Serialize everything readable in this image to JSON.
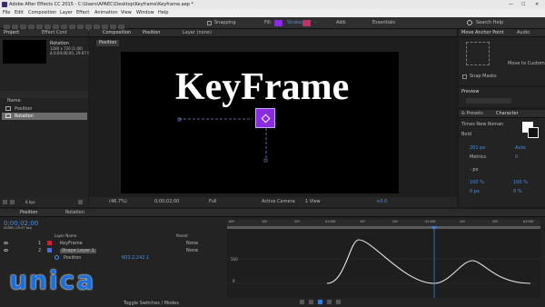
{
  "window": {
    "title": "Adobe After Effects CC 2015 - C:\\Users\\APAEC\\Desktop\\Keyframe\\Keyframe.aep *",
    "min": "—",
    "max": "☐",
    "close": "✕"
  },
  "menu": [
    "File",
    "Edit",
    "Composition",
    "Layer",
    "Effect",
    "Animation",
    "View",
    "Window",
    "Help"
  ],
  "toolbar": {
    "snapping": "Snapping",
    "fill": "Fill:",
    "stroke": "Stroke:",
    "stroke_value": "-",
    "add": "Add:",
    "workspace": "Essentials",
    "search": "Search Help"
  },
  "project": {
    "tab": "Project",
    "effect_tab": "Effect Cont",
    "comp_name": "Rotation",
    "comp_info1": "1280 x 720 (1.00)",
    "comp_info2": "Δ 0;00;00;00, 29.97 fps",
    "name_header": "Name",
    "items": [
      {
        "label": "Position"
      },
      {
        "label": "Rotation"
      }
    ],
    "bpc": "8 bpc"
  },
  "composition": {
    "tab": "Composition",
    "tab_name": "Position",
    "layer_tab": "Layer (none)",
    "sub_tab": "Position",
    "canvas_text": "KeyFrame",
    "zoom": "(46.7%)",
    "timecode": "0;00;02;00",
    "quality": "Full",
    "camera": "Active Camera",
    "views": "1 View",
    "exposure": "+0.0"
  },
  "move_anchor": {
    "tab": "Move Anchor Point",
    "audio_tab": "Audio",
    "move_to": "Move to Custom",
    "snap": "Snap Masks"
  },
  "preview": {
    "tab": "Preview"
  },
  "character": {
    "para_tab": "& Presets",
    "tab": "Character",
    "font": "Times New Roman",
    "style": "Bold",
    "size": "201 px",
    "leading": "Auto",
    "kerning": "Metrics",
    "tracking": "0",
    "px": "- px",
    "vscale": "100 %",
    "hscale": "100 %",
    "baseline": "0 px",
    "tsume": "0 %"
  },
  "timeline": {
    "tab": "Position",
    "tab2": "Rotation",
    "timecode": "0;00;02;00",
    "fps": "00060 (29.97 fps)",
    "col_layer": "Layer Name",
    "col_parent": "Parent",
    "layers": [
      {
        "num": "1",
        "name": "KeyFrame",
        "parent": "None"
      },
      {
        "num": "2",
        "name": "Shape Layer 1",
        "parent": "None"
      }
    ],
    "prop_name": "Position",
    "prop_value": "603.2,242.1",
    "toggle": "Toggle Switches / Modes",
    "ruler": [
      "00f",
      "10f",
      "20f",
      "01:00f",
      "10f",
      "20f",
      "02:00f",
      "10f",
      "20f",
      "03:00f"
    ],
    "graph_label_500": "500",
    "graph_label_0": "0"
  },
  "watermark": {
    "text": "unica"
  },
  "colors": {
    "accent_blue": "#3b7bd8",
    "keyframe_purple": "#8a2be2",
    "watermark_blue": "#1f6fd8"
  }
}
